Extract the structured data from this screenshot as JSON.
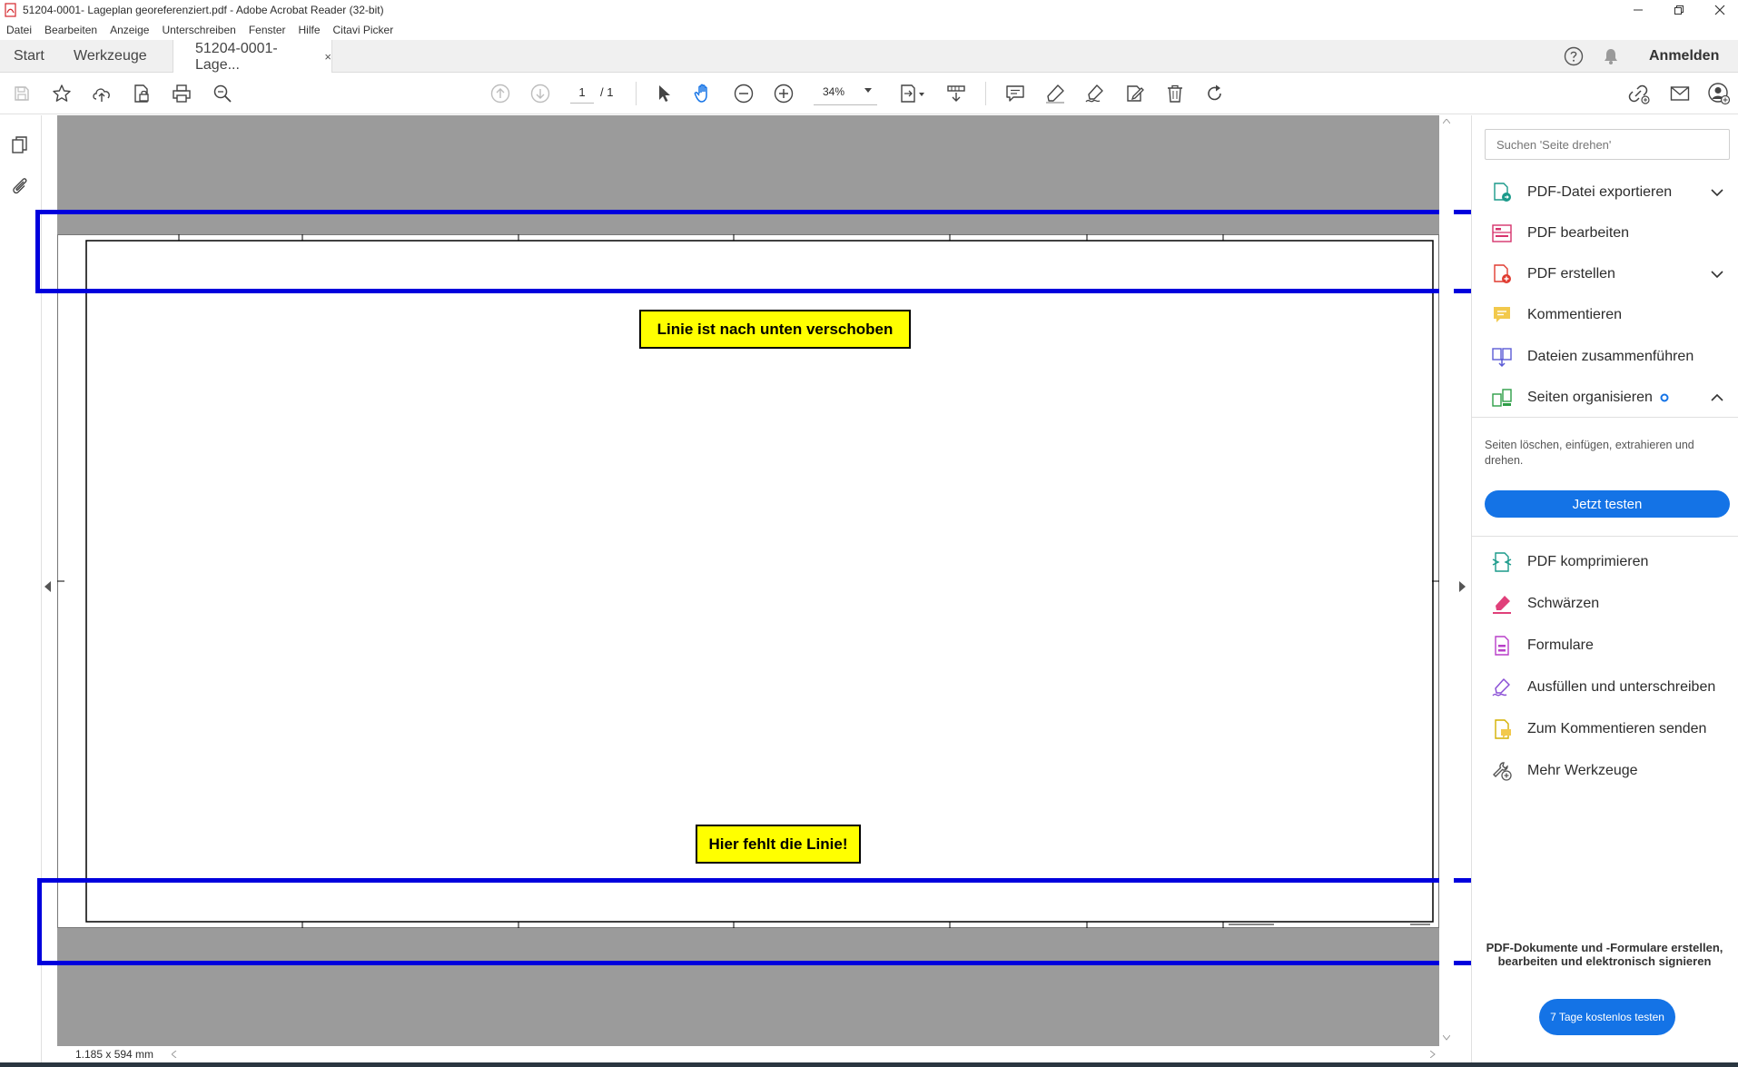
{
  "window": {
    "title": "51204-0001- Lageplan georeferenziert.pdf - Adobe Acrobat Reader (32-bit)"
  },
  "menu": [
    "Datei",
    "Bearbeiten",
    "Anzeige",
    "Unterschreiben",
    "Fenster",
    "Hilfe",
    "Citavi Picker"
  ],
  "tabs": {
    "start": "Start",
    "tools": "Werkzeuge",
    "document": "51204-0001- Lage...",
    "close": "×"
  },
  "account": {
    "signin": "Anmelden"
  },
  "toolbar": {
    "page_current": "1",
    "page_total": "/ 1",
    "zoom": "34%"
  },
  "annotations": {
    "top_note": "Linie ist nach unten verschoben",
    "bottom_note": "Hier fehlt die Linie!"
  },
  "status": {
    "page_size": "1.185 x 594 mm"
  },
  "right_pane": {
    "search_placeholder": "Suchen 'Seite drehen'",
    "tools": [
      {
        "label": "PDF-Datei exportieren",
        "icon": "export-pdf-icon",
        "expand": "chevron-down"
      },
      {
        "label": "PDF bearbeiten",
        "icon": "edit-pdf-icon"
      },
      {
        "label": "PDF erstellen",
        "icon": "create-pdf-icon",
        "expand": "chevron-down"
      },
      {
        "label": "Kommentieren",
        "icon": "comment-icon"
      },
      {
        "label": "Dateien zusammenführen",
        "icon": "combine-files-icon"
      },
      {
        "label": "Seiten organisieren",
        "icon": "organize-pages-icon",
        "expand": "chevron-up"
      }
    ],
    "organize_desc": "Seiten löschen, einfügen, extrahieren und drehen.",
    "try_button": "Jetzt testen",
    "more_tools": [
      {
        "label": "PDF komprimieren",
        "icon": "compress-pdf-icon"
      },
      {
        "label": "Schwärzen",
        "icon": "redact-icon"
      },
      {
        "label": "Formulare",
        "icon": "forms-icon"
      },
      {
        "label": "Ausfüllen und unterschreiben",
        "icon": "fill-sign-icon"
      },
      {
        "label": "Zum Kommentieren senden",
        "icon": "send-for-comments-icon"
      },
      {
        "label": "Mehr Werkzeuge",
        "icon": "more-tools-icon"
      }
    ],
    "promo_text": "PDF-Dokumente und -Formulare erstellen, bearbeiten und elektronisch signieren",
    "promo_button": "7 Tage kostenlos testen"
  },
  "colors": {
    "accent": "#1473e6",
    "note_bg": "#ffff00",
    "highlight_box": "#0000dd",
    "canvas_gray": "#9b9b9b"
  }
}
